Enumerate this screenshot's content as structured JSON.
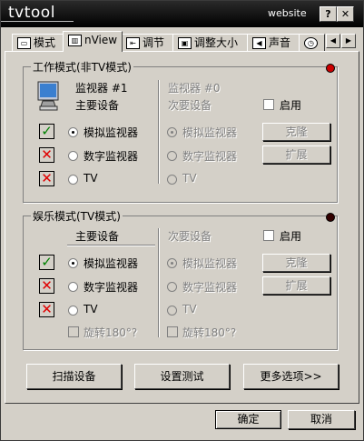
{
  "window": {
    "app_title": "tvtool",
    "website_label": "website",
    "help_btn": "?",
    "close_btn": "✕"
  },
  "tabs": [
    {
      "label": "模式",
      "icon": "mode-icon"
    },
    {
      "label": "nView",
      "icon": "nview-icon",
      "active": true
    },
    {
      "label": "调节",
      "icon": "adjust-icon"
    },
    {
      "label": "调整大小",
      "icon": "resize-icon"
    },
    {
      "label": "声音",
      "icon": "sound-icon"
    },
    {
      "label": "",
      "icon": "clock-icon"
    }
  ],
  "tab_scroll": {
    "left": "◀",
    "right": "▶"
  },
  "work_mode": {
    "title": "工作模式(非TV模式)",
    "primary": {
      "heading": "监视器 #1",
      "sub": "主要设备"
    },
    "secondary": {
      "heading": "监视器 #0",
      "sub": "次要设备",
      "enable_label": "启用"
    },
    "options": [
      "模拟监视器",
      "数字监视器",
      "TV"
    ],
    "primary_status": [
      "ok",
      "bad",
      "bad"
    ],
    "primary_selected": 0,
    "secondary_selected": 0,
    "clone_btn": "克隆",
    "extend_btn": "扩展"
  },
  "tv_mode": {
    "title": "娱乐模式(TV模式)",
    "primary": {
      "sub": "主要设备"
    },
    "secondary": {
      "sub": "次要设备",
      "enable_label": "启用"
    },
    "options": [
      "模拟监视器",
      "数字监视器",
      "TV"
    ],
    "primary_status": [
      "ok",
      "bad",
      "bad"
    ],
    "primary_selected": 0,
    "secondary_selected": 0,
    "rotate_label": "旋转180°?",
    "clone_btn": "克隆",
    "extend_btn": "扩展"
  },
  "actions": {
    "scan": "扫描设备",
    "test": "设置测试",
    "more": "更多选项>>"
  },
  "footer": {
    "ok": "确定",
    "cancel": "取消"
  },
  "colors": {
    "titlebar": "#000000",
    "face": "#d4d0c8",
    "ok": "#008000",
    "bad": "#e00000",
    "led_active": "#cc0000",
    "led_inactive": "#330000"
  }
}
